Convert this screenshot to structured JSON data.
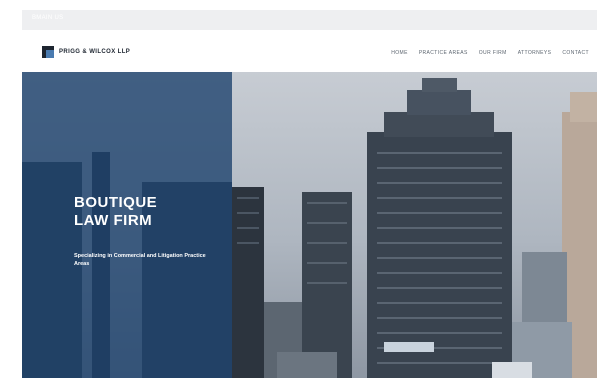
{
  "topbar": {
    "text": "BMAIN US"
  },
  "header": {
    "logo_text": "PRIGG & WILCOX LLP",
    "nav": [
      {
        "label": "HOME"
      },
      {
        "label": "PRACTICE AREAS"
      },
      {
        "label": "OUR FIRM"
      },
      {
        "label": "ATTORNEYS"
      },
      {
        "label": "CONTACT"
      }
    ]
  },
  "hero": {
    "title_line1": "BOUTIQUE",
    "title_line2": "LAW FIRM",
    "subtitle": "Specializing in Commercial and Litigation Practice Areas"
  },
  "colors": {
    "overlay": "#1b406c",
    "nav_text": "#5d6670",
    "brand_dark": "#1d2530",
    "brand_accent": "#4a7bb0"
  },
  "icons": {
    "logo": "logo-mark-icon"
  }
}
